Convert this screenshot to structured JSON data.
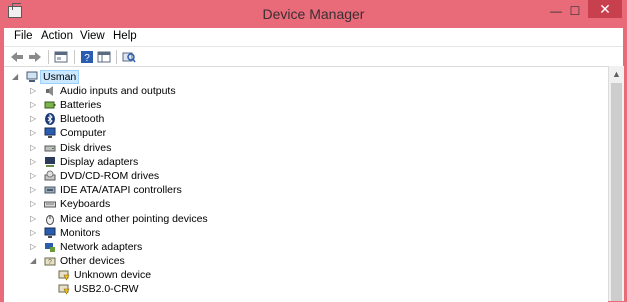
{
  "window": {
    "title": "Device Manager",
    "controls": {
      "minimize": "—",
      "maximize": "☐",
      "close": "✕"
    }
  },
  "menu": [
    "File",
    "Action",
    "View",
    "Help"
  ],
  "toolbar": [
    "back-icon",
    "forward-icon",
    "properties-icon",
    "help-icon",
    "console-tree-icon",
    "scan-hardware-icon"
  ],
  "tree": {
    "root": {
      "label": "Usman",
      "icon": "computer-icon"
    },
    "items": [
      {
        "label": "Audio inputs and outputs",
        "icon": "speaker-icon"
      },
      {
        "label": "Batteries",
        "icon": "battery-icon"
      },
      {
        "label": "Bluetooth",
        "icon": "bluetooth-icon"
      },
      {
        "label": "Computer",
        "icon": "monitor-icon"
      },
      {
        "label": "Disk drives",
        "icon": "disk-drive-icon"
      },
      {
        "label": "Display adapters",
        "icon": "display-adapter-icon"
      },
      {
        "label": "DVD/CD-ROM drives",
        "icon": "dvd-drive-icon"
      },
      {
        "label": "IDE ATA/ATAPI controllers",
        "icon": "ide-controller-icon"
      },
      {
        "label": "Keyboards",
        "icon": "keyboard-icon"
      },
      {
        "label": "Mice and other pointing devices",
        "icon": "mouse-icon"
      },
      {
        "label": "Monitors",
        "icon": "monitor-icon"
      },
      {
        "label": "Network adapters",
        "icon": "network-adapter-icon"
      },
      {
        "label": "Other devices",
        "icon": "unknown-device-icon",
        "expanded": true
      }
    ],
    "children": [
      {
        "label": "Unknown device",
        "icon": "warning-device-icon"
      },
      {
        "label": "USB2.0-CRW",
        "icon": "warning-device-icon"
      }
    ]
  },
  "colors": {
    "frame": "#e96a78",
    "close": "#c8404d",
    "selection": "#cce8ff"
  }
}
